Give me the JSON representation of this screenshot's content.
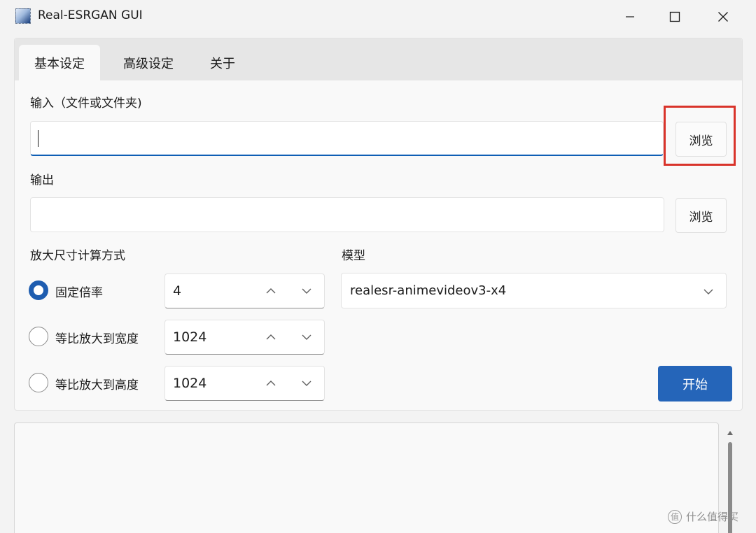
{
  "window": {
    "title": "Real-ESRGAN GUI",
    "icon": "app-image-icon",
    "controls": [
      "minimize-icon",
      "maximize-icon",
      "close-icon"
    ]
  },
  "tabs": [
    {
      "label": "基本设定",
      "selected": true
    },
    {
      "label": "高级设定",
      "selected": false
    },
    {
      "label": "关于",
      "selected": false
    }
  ],
  "input": {
    "label": "输入（文件或文件夹)",
    "value": "",
    "browse_label": "浏览"
  },
  "output": {
    "label": "输出",
    "value": "",
    "browse_label": "浏览"
  },
  "scale": {
    "section_label": "放大尺寸计算方式",
    "options": [
      {
        "label": "固定倍率",
        "checked": true,
        "value": "4"
      },
      {
        "label": "等比放大到宽度",
        "checked": false,
        "value": "1024"
      },
      {
        "label": "等比放大到高度",
        "checked": false,
        "value": "1024"
      }
    ]
  },
  "model": {
    "label": "模型",
    "selected": "realesr-animevideov3-x4"
  },
  "start_label": "开始",
  "log": {
    "text": ""
  },
  "watermark": {
    "logo": "值",
    "text": "什么值得买"
  },
  "colors": {
    "accent": "#2565b9",
    "highlight_box": "#d9342b"
  }
}
